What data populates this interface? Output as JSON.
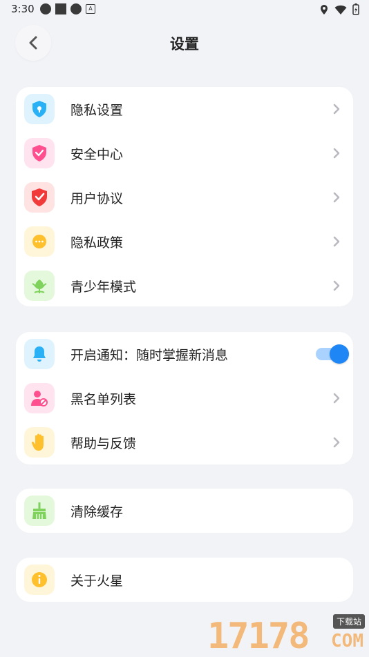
{
  "status_bar": {
    "time": "3:30",
    "left_icons": [
      "settings-circle-icon",
      "stop-square-icon",
      "settings-circle-icon",
      "text-a-icon"
    ],
    "right_icons": [
      "location-icon",
      "wifi-icon",
      "battery-icon"
    ]
  },
  "header": {
    "title": "设置",
    "back_icon": "chevron-left-icon"
  },
  "groups": [
    {
      "items": [
        {
          "label": "隐私设置",
          "icon": "shield-lock-icon",
          "icon_bg": "#dff3ff",
          "icon_color": "#2ab0f5"
        },
        {
          "label": "安全中心",
          "icon": "shield-check-icon",
          "icon_bg": "#ffe3ef",
          "icon_color": "#ff4f8e"
        },
        {
          "label": "用户协议",
          "icon": "shield-tick-icon",
          "icon_bg": "#ffe2e2",
          "icon_color": "#f13b3b"
        },
        {
          "label": "隐私政策",
          "icon": "chat-bubble-icon",
          "icon_bg": "#fff6d9",
          "icon_color": "#ffc02e"
        },
        {
          "label": "青少年模式",
          "icon": "sprout-icon",
          "icon_bg": "#e4f8dc",
          "icon_color": "#7fd25c"
        }
      ]
    },
    {
      "items": [
        {
          "label": "开启通知：随时掌握新消息",
          "icon": "bell-icon",
          "icon_bg": "#dff3ff",
          "icon_color": "#2ab0f5",
          "toggle": true
        },
        {
          "label": "黑名单列表",
          "icon": "user-block-icon",
          "icon_bg": "#ffe3ef",
          "icon_color": "#ff4f8e"
        },
        {
          "label": "帮助与反馈",
          "icon": "hand-icon",
          "icon_bg": "#fff6d9",
          "icon_color": "#ffc02e"
        }
      ]
    },
    {
      "items": [
        {
          "label": "清除缓存",
          "icon": "broom-icon",
          "icon_bg": "#e4f8dc",
          "icon_color": "#7fd25c"
        }
      ]
    },
    {
      "items": [
        {
          "label": "关于火星",
          "icon": "info-icon",
          "icon_bg": "#fff6d9",
          "icon_color": "#ffc02e"
        }
      ]
    }
  ],
  "notification_toggle_on": true,
  "watermark": {
    "number": "17178",
    "tag": "下载站",
    "suffix": "COM"
  }
}
